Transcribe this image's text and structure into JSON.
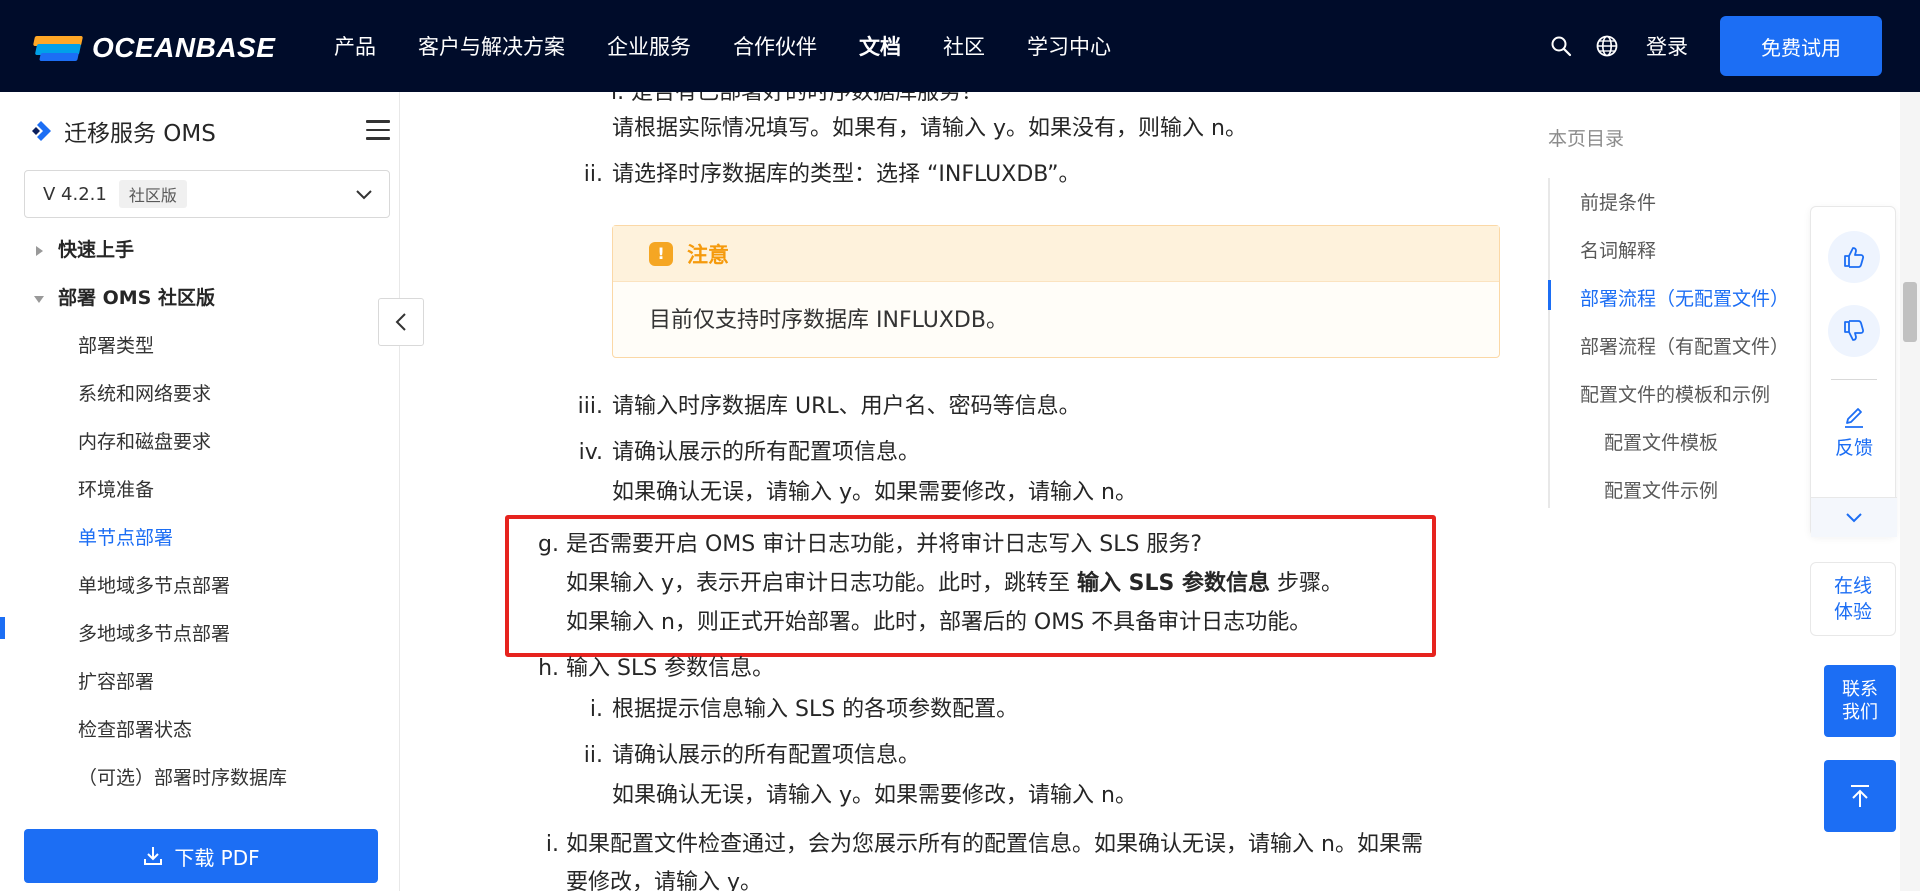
{
  "nav": {
    "logo_text": "OCEANBASE",
    "links": [
      "产品",
      "客户与解决方案",
      "企业服务",
      "合作伙伴",
      "文档",
      "社区",
      "学习中心"
    ],
    "active_link": "文档",
    "login": "登录",
    "trial": "免费试用"
  },
  "sidebar": {
    "title": "迁移服务 OMS",
    "version": "V 4.2.1",
    "version_badge": "社区版",
    "items": [
      {
        "label": "快速上手",
        "level": 0,
        "expand": "collapsed"
      },
      {
        "label": "部署 OMS 社区版",
        "level": 0,
        "expand": "expanded"
      },
      {
        "label": "部署类型",
        "level": 1
      },
      {
        "label": "系统和网络要求",
        "level": 1
      },
      {
        "label": "内存和磁盘要求",
        "level": 1
      },
      {
        "label": "环境准备",
        "level": 1
      },
      {
        "label": "单节点部署",
        "level": 1,
        "active": true
      },
      {
        "label": "单地域多节点部署",
        "level": 1
      },
      {
        "label": "多地域多节点部署",
        "level": 1
      },
      {
        "label": "扩容部署",
        "level": 1
      },
      {
        "label": "检查部署状态",
        "level": 1
      },
      {
        "label": "（可选）部署时序数据库",
        "level": 1
      }
    ],
    "download": "下载 PDF"
  },
  "content": {
    "partial_top": "i. 是否有已部署好的时序数据库服务？",
    "step_i_detail": "请根据实际情况填写。如果有，请输入 y。如果没有，则输入 n。",
    "step_ii_marker": "ii.",
    "step_ii": "请选择时序数据库的类型：选择 “INFLUXDB”。",
    "notice_title": "注意",
    "notice_body": "目前仅支持时序数据库 INFLUXDB。",
    "step_iii_marker": "iii.",
    "step_iii": "请输入时序数据库 URL、用户名、密码等信息。",
    "step_iv_marker": "iv.",
    "step_iv": "请确认展示的所有配置项信息。",
    "step_iv_detail": "如果确认无误，请输入 y。如果需要修改，请输入 n。",
    "g_marker": "g.",
    "g_title": "是否需要开启 OMS 审计日志功能，并将审计日志写入 SLS 服务?",
    "g_line2_pre": "如果输入 y，表示开启审计日志功能。此时，跳转至 ",
    "g_line2_bold": "输入 SLS 参数信息",
    "g_line2_post": " 步骤。",
    "g_line3": "如果输入 n，则正式开始部署。此时，部署后的 OMS 不具备审计日志功能。",
    "h_marker": "h.",
    "h_title": "输入 SLS 参数信息。",
    "h_i_marker": "i.",
    "h_i": "根据提示信息输入 SLS 的各项参数配置。",
    "h_ii_marker": "ii.",
    "h_ii": "请确认展示的所有配置项信息。",
    "h_ii_detail": "如果确认无误，请输入 y。如果需要修改，请输入 n。",
    "last_marker": "i.",
    "last_line1": "如果配置文件检查通过，会为您展示所有的配置信息。如果确认无误，请输入 n。如果需",
    "last_line2": "要修改，请输入 y。"
  },
  "toc": {
    "title": "本页目录",
    "items": [
      {
        "label": "前提条件",
        "level": 0
      },
      {
        "label": "名词解释",
        "level": 0
      },
      {
        "label": "部署流程（无配置文件）",
        "level": 0,
        "active": true
      },
      {
        "label": "部署流程（有配置文件）",
        "level": 0
      },
      {
        "label": "配置文件的模板和示例",
        "level": 0
      },
      {
        "label": "配置文件模板",
        "level": 1
      },
      {
        "label": "配置文件示例",
        "level": 1
      }
    ]
  },
  "floating": {
    "feedback": "反馈",
    "online_1": "在线",
    "online_2": "体验",
    "contact_1": "联系",
    "contact_2": "我们"
  },
  "colors": {
    "nav_bg": "#000c2a",
    "accent": "#1c6ef4",
    "warning": "#f59a0c",
    "highlight_box": "#e6231e"
  },
  "icons": [
    "search-icon",
    "globe-icon",
    "menu-icon",
    "chevron-down-icon",
    "chevron-left-icon",
    "download-icon",
    "thumbs-up-icon",
    "thumbs-down-icon",
    "edit-icon",
    "arrow-up-icon",
    "warning-icon"
  ]
}
